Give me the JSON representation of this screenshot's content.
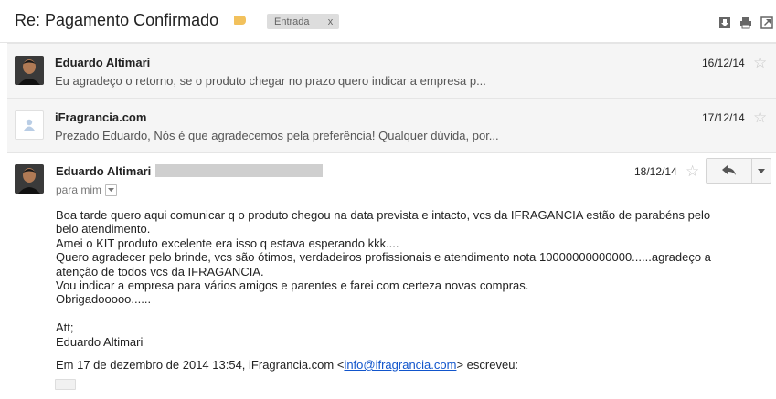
{
  "thread": {
    "subject": "Re: Pagamento Confirmado",
    "label": "Entrada",
    "label_remove": "x",
    "label_color": "#f2c15c",
    "toolbar_icons": [
      "download-icon",
      "print-icon",
      "new-window-icon"
    ]
  },
  "messages": [
    {
      "sender": "Eduardo Altimari",
      "date": "16/12/14",
      "snippet": "Eu agradeço o retorno, se o produto chegar no prazo quero indicar a empresa p...",
      "avatar": "photo"
    },
    {
      "sender": "iFragrancia.com",
      "date": "17/12/14",
      "snippet": "Prezado Eduardo, Nós é que agradecemos pela preferência! Qualquer dúvida, por...",
      "avatar": "default-person"
    }
  ],
  "expanded": {
    "sender": "Eduardo Altimari",
    "date": "18/12/14",
    "to": "para mim",
    "body": [
      "Boa tarde quero aqui comunicar q o produto chegou na data prevista e intacto, vcs da IFRAGANCIA estão de parabéns pelo belo atendimento.",
      "Amei o KIT produto excelente era isso q estava esperando kkk....",
      "Quero agradecer pelo brinde, vcs são ótimos, verdadeiros profissionais e atendimento nota 10000000000000......agradeço a atenção de todos vcs da IFRAGANCIA.",
      "Vou indicar a empresa para vários amigos e parentes e farei com certeza novas compras.",
      "Obrigadooooo......",
      "",
      "Att;",
      "Eduardo Altimari"
    ],
    "quote_prefix": "Em 17 de dezembro de 2014 13:54, iFragrancia.com <",
    "quote_email": "info@ifragrancia.com",
    "quote_suffix": "> escreveu:",
    "show_trimmed": "···"
  }
}
